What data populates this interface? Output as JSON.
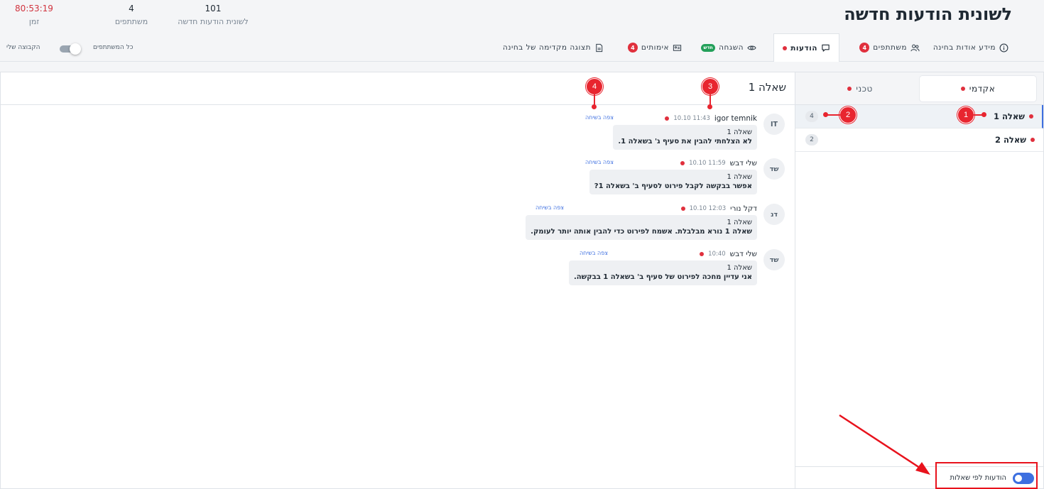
{
  "header": {
    "title": "לשונית הודעות חדשה",
    "stats": {
      "time": {
        "value": "80:53:19",
        "label": "זמן"
      },
      "participants": {
        "value": "4",
        "label": "משתתפים"
      },
      "wall": {
        "value": "101",
        "label": "לשונית הודעות חדשה"
      }
    }
  },
  "tabs": [
    {
      "label": "מידע אודות בחינה",
      "icon": "info-icon"
    },
    {
      "label": "משתתפים",
      "icon": "people-icon",
      "badge": "4"
    },
    {
      "label": "הודעות",
      "icon": "chat-icon",
      "active": true
    },
    {
      "label": "השגחה",
      "icon": "eye-icon",
      "chip": "חדש"
    },
    {
      "label": "אימותים",
      "icon": "id-card-icon",
      "badge": "4"
    },
    {
      "label": "תצוגה מקדימה של בחינה",
      "icon": "document-icon"
    }
  ],
  "filters": {
    "all_participants": "כל המשתתפים",
    "my_group": "הקבוצה שלי"
  },
  "categories": [
    {
      "label": "אקדמי",
      "active": true
    },
    {
      "label": "טכני",
      "active": false
    }
  ],
  "questions": [
    {
      "name": "שאלה 1",
      "count": "4",
      "active": true
    },
    {
      "name": "שאלה 2",
      "count": "2",
      "active": false
    }
  ],
  "by_questions_label": "הודעות לפי שאלות",
  "messages_title": "שאלה 1",
  "messages": [
    {
      "initials": "IT",
      "author": "igor temnik",
      "time": "11:43 10.10",
      "watch": "צפה בשיחה",
      "question": "שאלה 1",
      "text": "לא הצלחתי להבין את סעיף ג' בשאלה 1."
    },
    {
      "initials": "שד",
      "author": "שלי דבש",
      "time": "11:59 10.10",
      "watch": "צפה בשיחה",
      "question": "שאלה 1",
      "text": "אפשר בבקשה לקבל פירוט לסעיף ב' בשאלה 1?"
    },
    {
      "initials": "דנ",
      "author": "דקל נורי",
      "time": "12:03 10.10",
      "watch": "צפה בשיחה",
      "question": "שאלה 1",
      "text": "שאלה 1 נורא מבלבלת. אשמח לפירוט כדי להבין אותה יותר לעומק."
    },
    {
      "initials": "שד",
      "author": "שלי דבש",
      "time": "10:40",
      "watch": "צפה בשיחה",
      "question": "שאלה 1",
      "text": "אני עדיין מחכה לפירוט של סעיף ב' בשאלה 1 בבקשה."
    }
  ],
  "markers": [
    "1",
    "2",
    "3",
    "4"
  ],
  "colors": {
    "accent": "#3d6fe0",
    "alert": "#e0303d",
    "new": "#23a05a"
  }
}
